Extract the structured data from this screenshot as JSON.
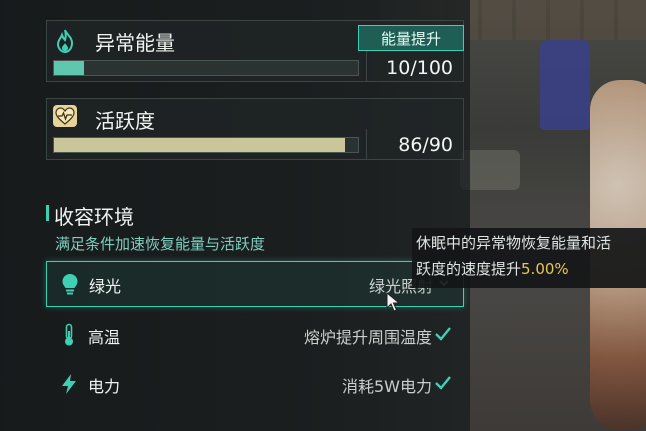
{
  "anomaly_energy": {
    "title": "异常能量",
    "boost_label": "能量提升",
    "progress": 0.1,
    "value_text": "10/100",
    "icon": "flame-icon",
    "bar_color": "#5fc7ad"
  },
  "activity": {
    "title": "活跃度",
    "progress": 0.956,
    "value_text": "86/90",
    "icon": "heartbeat-icon",
    "bar_color": "#c9c79a"
  },
  "containment": {
    "title": "收容环境",
    "description": "满足条件加速恢复能量与活跃度",
    "rows": [
      {
        "label": "绿光",
        "status": "绿光照射",
        "icon": "lightbulb-icon",
        "selected": true,
        "mark": "dropdown"
      },
      {
        "label": "高温",
        "status": "熔炉提升周围温度",
        "icon": "thermometer-icon",
        "selected": false,
        "mark": "check"
      },
      {
        "label": "电力",
        "status": "消耗5W电力",
        "icon": "lightning-icon",
        "selected": false,
        "mark": "check"
      }
    ]
  },
  "tooltip": {
    "line1": "休眠中的异常物恢复能量和活",
    "line2_prefix": "跃度的速度提升",
    "line2_value": "5.00%"
  },
  "colors": {
    "accent": "#3fd0b4",
    "highlight": "#e6c65a"
  }
}
